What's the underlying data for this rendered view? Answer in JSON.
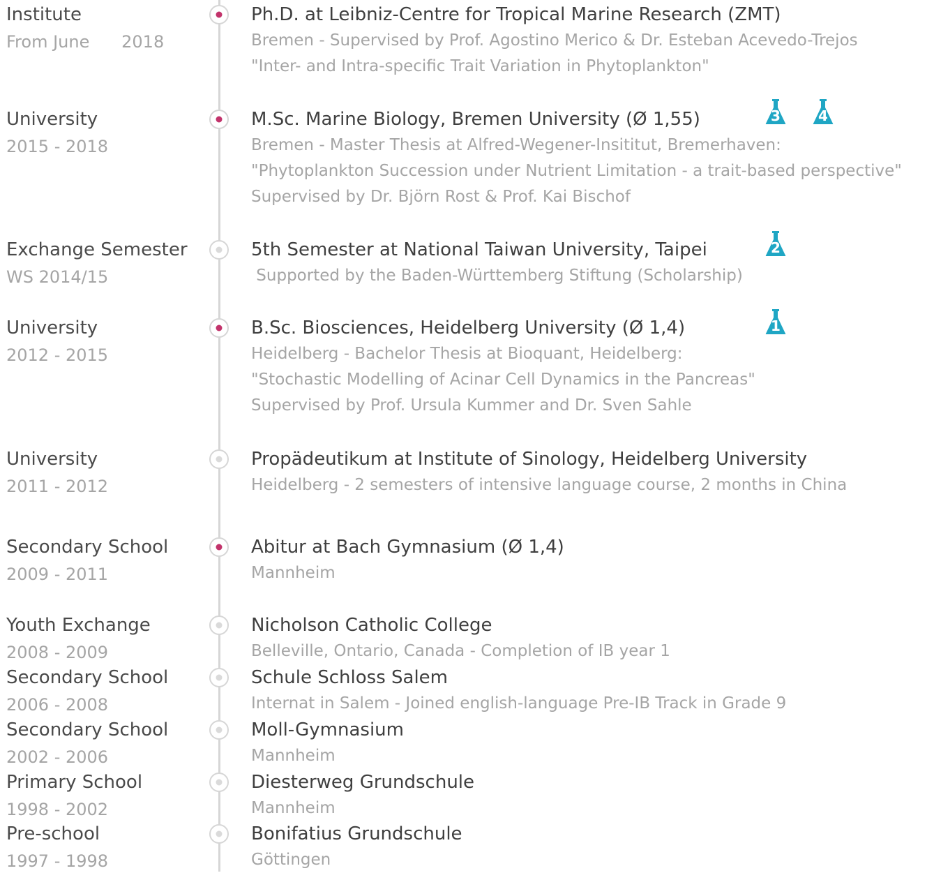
{
  "entries": [
    {
      "label": "Institute",
      "date": "From June      2018",
      "title": "Ph.D. at Leibniz-Centre for Tropical Marine Research (ZMT)",
      "lines": [
        "Bremen - Supervised by Prof. Agostino Merico & Dr. Esteban Acevedo-Trejos",
        "\"Inter- and Intra-specific Trait Variation in Phytoplankton\""
      ],
      "marker": "accent"
    },
    {
      "label": "University",
      "date": "2015 - 2018",
      "title": "M.Sc. Marine Biology, Bremen University (Ø 1,55)",
      "lines": [
        "Bremen - Master Thesis at Alfred-Wegener-Insititut, Bremerhaven:",
        "\"Phytoplankton Succession under Nutrient Limitation - a trait-based perspective\"",
        "Supervised by Dr. Björn Rost & Prof. Kai Bischof"
      ],
      "marker": "accent",
      "badges": [
        "3",
        "4"
      ]
    },
    {
      "label": "Exchange Semester",
      "date": "WS 2014/15",
      "title": "5th Semester at National Taiwan University, Taipei",
      "lines": [
        " Supported by the Baden-Württemberg Stiftung (Scholarship)"
      ],
      "marker": "plain",
      "badges": [
        "2"
      ]
    },
    {
      "label": "University",
      "date": "2012 - 2015",
      "title": "B.Sc. Biosciences, Heidelberg University (Ø 1,4)",
      "lines": [
        "Heidelberg - Bachelor Thesis at Bioquant, Heidelberg:",
        "\"Stochastic Modelling of Acinar Cell Dynamics in the Pancreas\"",
        "Supervised by Prof. Ursula Kummer and Dr. Sven Sahle"
      ],
      "marker": "accent",
      "badges": [
        "1"
      ]
    },
    {
      "label": "University",
      "date": "2011 - 2012",
      "title": "Propädeutikum at Institute of Sinology, Heidelberg University",
      "lines": [
        "Heidelberg - 2 semesters of intensive language course, 2 months in China"
      ],
      "marker": "plain"
    },
    {
      "label": "Secondary School",
      "date": "2009 - 2011",
      "title": "Abitur at Bach Gymnasium (Ø 1,4)",
      "lines": [
        "Mannheim"
      ],
      "marker": "accent"
    },
    {
      "label": "Youth Exchange",
      "date": "2008 - 2009",
      "title": "Nicholson Catholic College",
      "lines": [
        "Belleville, Ontario, Canada - Completion of IB year 1"
      ],
      "marker": "plain"
    },
    {
      "label": "Secondary School",
      "date": "2006 - 2008",
      "title": "Schule Schloss Salem",
      "lines": [
        "Internat in Salem - Joined english-language Pre-IB Track in Grade 9"
      ],
      "marker": "plain"
    },
    {
      "label": "Secondary School",
      "date": "2002 - 2006",
      "title": "Moll-Gymnasium",
      "lines": [
        "Mannheim"
      ],
      "marker": "plain"
    },
    {
      "label": "Primary School",
      "date": "1998 - 2002",
      "title": "Diesterweg Grundschule",
      "lines": [
        "Mannheim"
      ],
      "marker": "plain"
    },
    {
      "label": "Pre-school",
      "date": "1997 - 1998",
      "title": "Bonifatius Grundschule",
      "lines": [
        "Göttingen"
      ],
      "marker": "plain"
    }
  ],
  "colors": {
    "accent": "#c2336b",
    "badge": "#1fa6c4",
    "line": "#d6d6d6",
    "label": "#4a4a4a",
    "muted": "#a5a5a5"
  },
  "icons": {
    "marker": "timeline-dot-icon",
    "badge": "flask-icon"
  }
}
